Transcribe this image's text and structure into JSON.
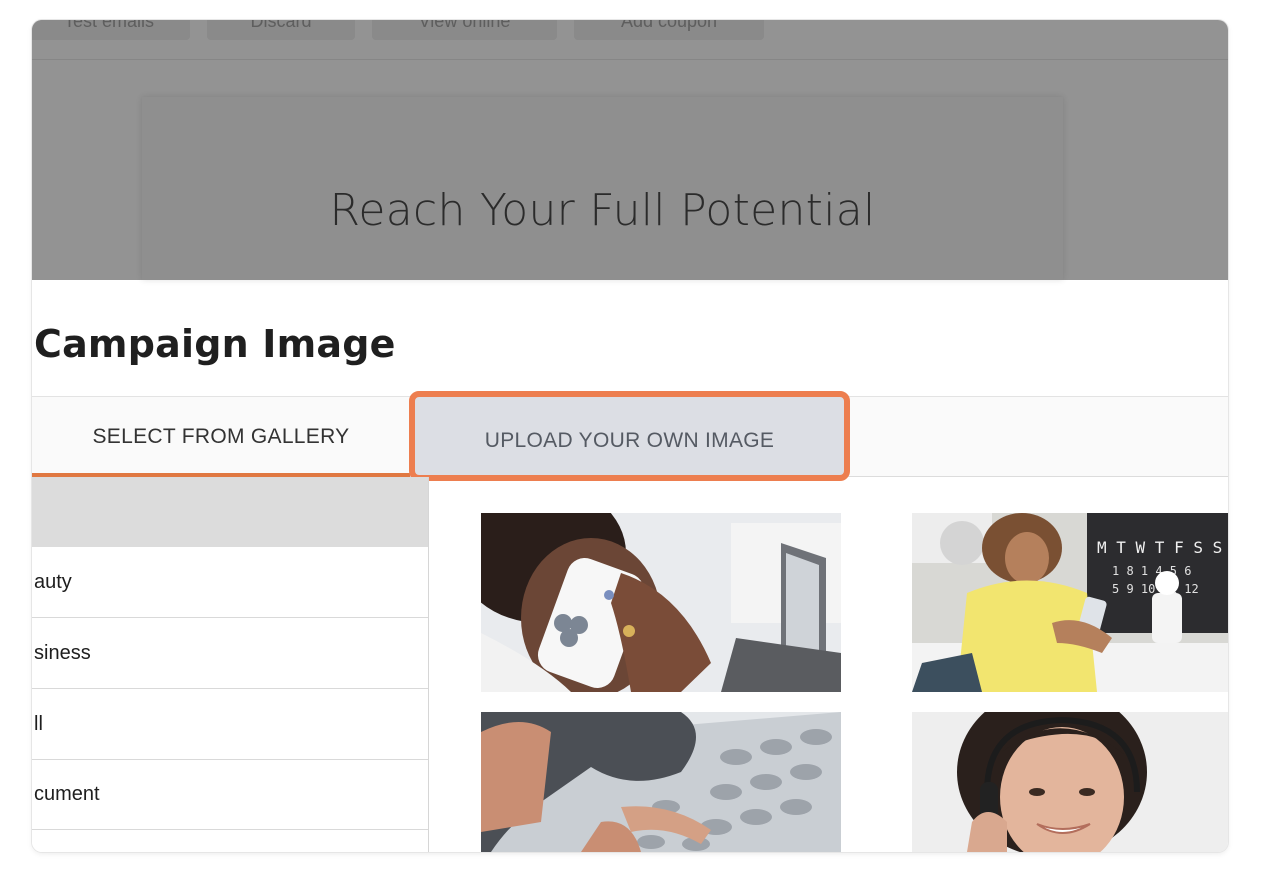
{
  "toolbar": {
    "buttons": [
      {
        "label": "Test emails"
      },
      {
        "label": "Discard"
      },
      {
        "label": "View online"
      },
      {
        "label": "Add coupon"
      }
    ]
  },
  "email_preview": {
    "headline": "Reach Your Full Potential"
  },
  "dialog": {
    "title": "Campaign Image",
    "tabs": [
      {
        "label": "SELECT FROM GALLERY",
        "active": true
      },
      {
        "label": "UPLOAD YOUR OWN IMAGE",
        "highlighted": true
      }
    ],
    "categories": [
      {
        "label": "auty"
      },
      {
        "label": "siness"
      },
      {
        "label": "ll"
      },
      {
        "label": "cument"
      }
    ],
    "gallery_images": [
      {
        "icon": "woman-on-phone-image"
      },
      {
        "icon": "woman-texting-image"
      },
      {
        "icon": "desk-phone-dialing-image"
      },
      {
        "icon": "headset-agent-image"
      }
    ]
  },
  "colors": {
    "accent": "#e07841",
    "highlight_outline": "#ed7e4f",
    "overlay": "#939393"
  }
}
